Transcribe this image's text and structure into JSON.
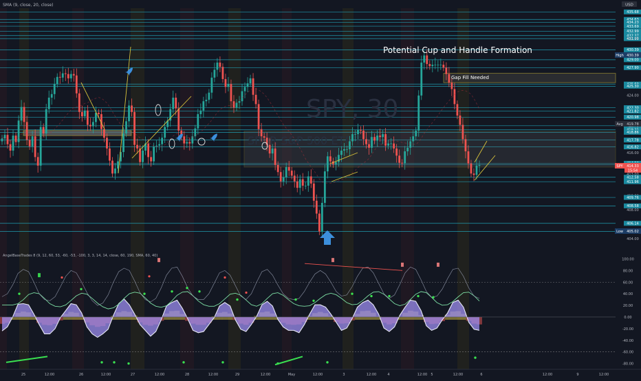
{
  "window": {
    "top_indicator_label": "SMA (9, close, 20, close)",
    "currency": "USD",
    "watermark_symbol": "SPY, 30",
    "watermark_name": "SPDR S&P 500 ETF TRUST"
  },
  "annotations": {
    "headline": "Potential Cup and Handle Formation",
    "gap_fill": "Gap Fill Needed"
  },
  "price_axis": {
    "labels": [
      "435.68",
      "434.63",
      "434.23",
      "433.69",
      "432.99",
      "432.37",
      "431.95",
      "432.00",
      "430.39",
      "429.00",
      "427.90",
      "425.60",
      "425.30",
      "424.00",
      "422.30",
      "421.82",
      "420.98",
      "420.00",
      "419.78",
      "419.21",
      "418.86",
      "417.78",
      "416.82",
      "416.00",
      "414.53",
      "414.33",
      "413.00",
      "412.58",
      "411.96",
      "410.00",
      "409.76",
      "408.58",
      "408.00",
      "406.14",
      "405.02",
      "404.00"
    ],
    "badges": {
      "high": "High",
      "high_value": "430.39",
      "avg": "Avg",
      "avg_value": "419.78",
      "symbol": "SPY",
      "last_price": "414.33",
      "countdown": "15:54",
      "low": "Low",
      "low_value": "405.02"
    }
  },
  "time_axis": {
    "labels": [
      "25",
      "12:00",
      "26",
      "12:00",
      "27",
      "12:00",
      "28",
      "12:00",
      "29",
      "12:00",
      "May",
      "12:00",
      "3",
      "12:00",
      "4",
      "12:00",
      "5",
      "12:00",
      "6",
      "12:00",
      "9",
      "12:00"
    ]
  },
  "oscillator": {
    "label": "AngelBaseTrades 8 (9, 12, 60, 53, -60, -53, -100, 3, 3, 14, 14, close, 60, 190, SMA, 60, 40)",
    "axis_labels": [
      "100.00",
      "80.00",
      "60.00",
      "40.00",
      "20.00",
      "0.00",
      "-20.00",
      "-40.00",
      "-60.00",
      "-80.00"
    ]
  },
  "colors": {
    "background": "#131722",
    "up_candle": "#26a69a",
    "down_candle": "#ef5350",
    "level_line": "#22b3c9",
    "zone_border": "#d8c23b",
    "osc_purple": "#9c8df0",
    "osc_white": "#e7e9f5",
    "osc_green": "#7de0a5",
    "osc_yellow": "#c9b545",
    "osc_red": "#e05555",
    "accent_blue": "#2f84d6"
  },
  "chart_data": {
    "type": "candlestick",
    "title": "",
    "x_range_labels": [
      "25",
      "May",
      "12:00"
    ],
    "ylim": [
      404,
      436
    ],
    "oscillator_ylim": [
      -90,
      110
    ],
    "series": [
      {
        "name": "SPY, 30",
        "close": [
          418,
          418.5,
          417.2,
          416.3,
          418.4,
          417.5,
          420.5,
          422.4,
          420.3,
          417.8,
          416.9,
          418.3,
          415.4,
          414.2,
          419.6,
          418.7,
          422.1,
          423.7,
          424.2,
          425.6,
          426.6,
          426.5,
          427.1,
          427.0,
          426.4,
          427.0,
          426.8,
          424.3,
          421.7,
          421.1,
          421.9,
          419.9,
          419.7,
          420.3,
          421.6,
          421.4,
          419.3,
          418.1,
          416.6,
          414.9,
          413.1,
          413.8,
          414.8,
          416.1,
          418.7,
          420.4,
          422.6,
          421.7,
          417.1,
          416.6,
          414.7,
          416.3,
          417.3,
          415.4,
          414.8,
          416.9,
          417.0,
          417.2,
          418.1,
          419.6,
          420.5,
          422.1,
          423.7,
          422.2,
          419.1,
          418.3,
          417.3,
          417.5,
          417.3,
          418.3,
          419.4,
          421.4,
          421.9,
          423.2,
          423.4,
          424.4,
          426.5,
          427.6,
          428.6,
          428.0,
          426.3,
          425.2,
          425.6,
          423.2,
          422.3,
          423.0,
          423.2,
          424.6,
          425.2,
          425.7,
          426.4,
          424.1,
          422.8,
          419.3,
          418.3,
          418.1,
          417.1,
          415.9,
          416.6,
          414.3,
          413.3,
          412.0,
          412.6,
          414.0,
          413.5,
          412.8,
          412.0,
          411.1,
          412.3,
          411.4,
          411.4,
          412.7,
          411.7,
          409.3,
          407.5,
          405.0,
          409.0,
          413.4,
          415.5,
          414.8,
          414.4,
          414.7,
          415.7,
          416.3,
          416.5,
          416.5,
          417.6,
          418.6,
          418.6,
          419.2,
          419.1,
          417.9,
          417.2,
          416.7,
          418.2,
          417.7,
          418.4,
          418.2,
          418.6,
          417.0,
          417.3,
          417.3,
          416.6,
          415.6,
          414.6,
          414.5,
          416.2,
          416.7,
          417.6,
          418.3,
          419.1,
          424.0,
          428.6,
          429.6,
          428.4,
          428.1,
          428.3,
          428.3,
          428.3,
          428.3,
          427.9,
          427.0,
          425.8,
          424.9,
          422.8,
          421.2,
          419.9,
          417.9,
          416.2,
          414.5,
          413.1,
          412.9,
          414.2,
          414.3
        ]
      },
      {
        "name": "SMA 9",
        "values_note": ""
      },
      {
        "name": "SMA 20",
        "values_note": ""
      }
    ],
    "levels": [
      435.68,
      434.63,
      434.23,
      433.69,
      432.99,
      432.37,
      431.95,
      430.39,
      429.0,
      427.9,
      425.6,
      425.3,
      422.3,
      421.82,
      420.98,
      419.78,
      419.21,
      418.86,
      417.78,
      416.82,
      414.53,
      414.33,
      412.58,
      411.96,
      409.76,
      408.58,
      406.14,
      405.02
    ],
    "zones": [
      {
        "label": "",
        "from": 418.4,
        "to": 419.1
      },
      {
        "label": "",
        "from": 414.0,
        "to": 419.0
      },
      {
        "label": "Gap Fill Needed",
        "from": 425.8,
        "to": 427.1
      }
    ],
    "oscillator_series": [
      {
        "name": "",
        "values": [
          35,
          40,
          55,
          75,
          82,
          78,
          60,
          40,
          30,
          28,
          35,
          52,
          70,
          80,
          76,
          60,
          42,
          28,
          20,
          24,
          38,
          60,
          78,
          84,
          80,
          62,
          42,
          30,
          26,
          32,
          50,
          72,
          84,
          86,
          70,
          50,
          36,
          30,
          30,
          40,
          58,
          76,
          80,
          72,
          54,
          36,
          30,
          40,
          60,
          78,
          82,
          72,
          55,
          40,
          32,
          30,
          32,
          44,
          60,
          74,
          80,
          74,
          60,
          44,
          36,
          38,
          52,
          70,
          84,
          86,
          76,
          58,
          40,
          32,
          38,
          56,
          76,
          86,
          82,
          64,
          44,
          34,
          36,
          48,
          66,
          82,
          84,
          70,
          50,
          36,
          32
        ]
      }
    ]
  }
}
